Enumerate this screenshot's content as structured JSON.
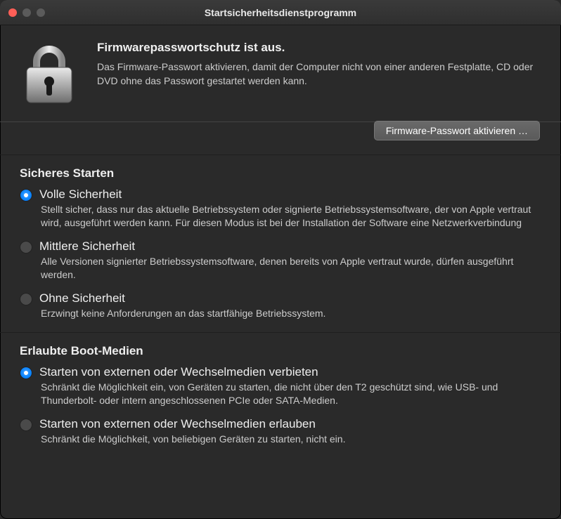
{
  "window": {
    "title": "Startsicherheitsdienstprogramm"
  },
  "firmware": {
    "heading": "Firmwarepasswortschutz ist aus.",
    "description": "Das Firmware-Passwort aktivieren, damit der Computer nicht von einer anderen Festplatte, CD oder DVD ohne das Passwort gestartet werden kann.",
    "button_label": "Firmware-Passwort aktivieren …"
  },
  "secure_boot": {
    "title": "Sicheres Starten",
    "options": [
      {
        "label": "Volle Sicherheit",
        "description": "Stellt sicher, dass nur das aktuelle Betriebssystem oder signierte Betriebssystemsoftware, der von Apple vertraut wird, ausgeführt werden kann. Für diesen Modus ist bei der Installation der Software eine Netzwerkverbindung",
        "selected": true
      },
      {
        "label": "Mittlere Sicherheit",
        "description": "Alle Versionen signierter Betriebssystemsoftware, denen bereits von Apple vertraut wurde, dürfen ausgeführt werden.",
        "selected": false
      },
      {
        "label": "Ohne Sicherheit",
        "description": "Erzwingt keine Anforderungen an das startfähige Betriebssystem.",
        "selected": false
      }
    ]
  },
  "boot_media": {
    "title": "Erlaubte Boot-Medien",
    "options": [
      {
        "label": "Starten von externen oder Wechselmedien verbieten",
        "description": "Schränkt die Möglichkeit ein, von Geräten zu starten, die nicht über den T2 geschützt sind, wie USB- und Thunderbolt- oder intern angeschlossenen PCIe oder SATA-Medien.",
        "selected": true
      },
      {
        "label": "Starten von externen oder Wechselmedien erlauben",
        "description": "Schränkt die Möglichkeit, von beliebigen Geräten zu starten, nicht ein.",
        "selected": false
      }
    ]
  }
}
